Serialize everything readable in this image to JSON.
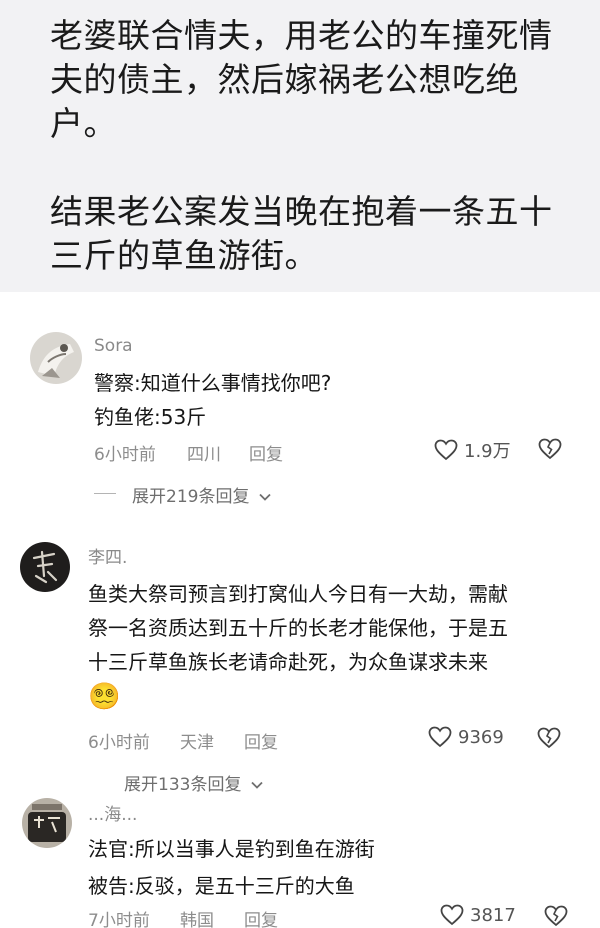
{
  "post": {
    "paragraph1": "老婆联合情夫，用老公的车撞死情夫的债主，然后嫁祸老公想吃绝户。",
    "paragraph2": "结果老公案发当晚在抱着一条五十三斤的草鱼游街。"
  },
  "comments": [
    {
      "username": "Sora",
      "lines": [
        "警察:知道什么事情找你吧?",
        "钓鱼佬:53斤"
      ],
      "time": "6小时前",
      "location": "四川",
      "reply_label": "回复",
      "likes": "1.9万",
      "expand_label": "展开219条回复"
    },
    {
      "username": "李四.",
      "lines": [
        "鱼类大祭司预言到打窝仙人今日有一大劫，需献",
        "祭一名资质达到五十斤的长老才能保他，于是五",
        "十三斤草鱼族长老请命赴死，为众鱼谋求未来"
      ],
      "emoji": "😵‍💫",
      "time": "6小时前",
      "location": "天津",
      "reply_label": "回复",
      "likes": "9369",
      "expand_label": "展开133条回复"
    },
    {
      "username": "...海...",
      "lines": [
        "法官:所以当事人是钓到鱼在游街",
        "被告:反驳，是五十三斤的大鱼"
      ],
      "time": "7小时前",
      "location": "韩国",
      "reply_label": "回复",
      "likes": "3817"
    }
  ]
}
